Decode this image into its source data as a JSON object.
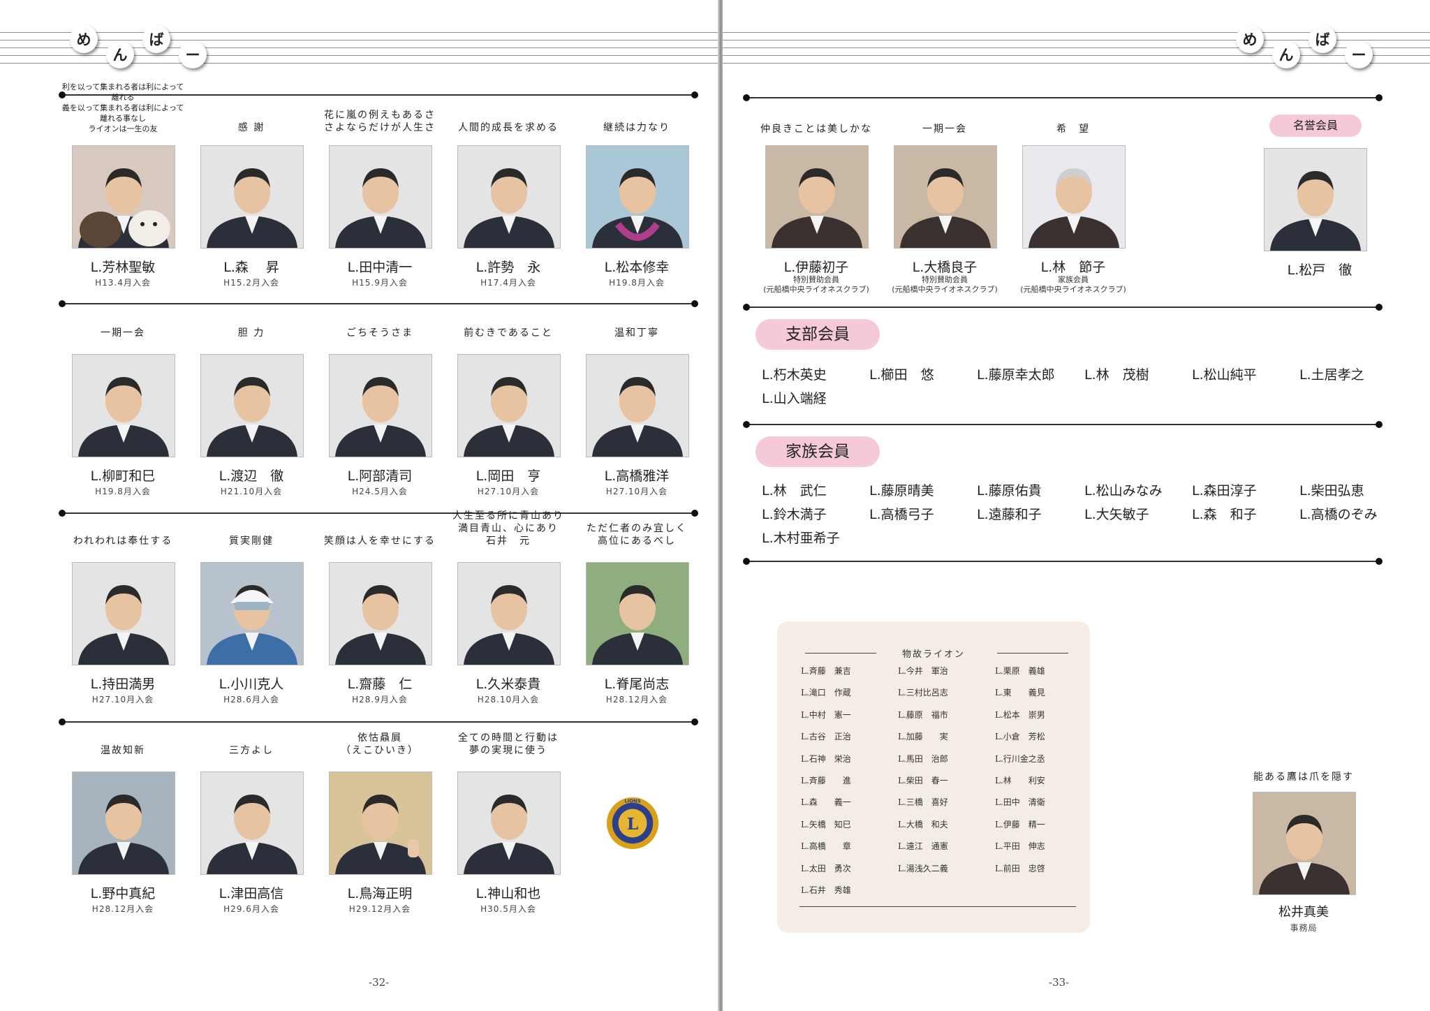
{
  "header": {
    "title_chars": [
      "め",
      "ん",
      "ば",
      "ー"
    ]
  },
  "left_page": {
    "page_number": "-32-",
    "members": [
      {
        "motto": "利を以って集まれる者は利によって離れる\n義を以って集まれる者は利によって離れる事なし\nライオンは一生の友",
        "name": "L.芳林聖敏",
        "joined": "H13.4月入会",
        "photo": "person-with-dogs"
      },
      {
        "motto": "感 謝",
        "name": "L.森　 昇",
        "joined": "H15.2月入会",
        "photo": "portrait"
      },
      {
        "motto": "花に嵐の例えもあるさ\nさよならだけが人生さ",
        "name": "L.田中清一",
        "joined": "H15.9月入会",
        "photo": "portrait"
      },
      {
        "motto": "人間的成長を求める",
        "name": "L.許勢　永",
        "joined": "H17.4月入会",
        "photo": "portrait"
      },
      {
        "motto": "継続は力なり",
        "name": "L.松本修幸",
        "joined": "H19.8月入会",
        "photo": "portrait-lei"
      },
      {
        "motto": "一期一会",
        "name": "L.柳町和巳",
        "joined": "H19.8月入会",
        "photo": "portrait"
      },
      {
        "motto": "胆 力",
        "name": "L.渡辺　徹",
        "joined": "H21.10月入会",
        "photo": "portrait"
      },
      {
        "motto": "ごちそうさま",
        "name": "L.阿部清司",
        "joined": "H24.5月入会",
        "photo": "portrait"
      },
      {
        "motto": "前むきであること",
        "name": "L.岡田　亨",
        "joined": "H27.10月入会",
        "photo": "portrait"
      },
      {
        "motto": "温和丁寧",
        "name": "L.高橋雅洋",
        "joined": "H27.10月入会",
        "photo": "portrait"
      },
      {
        "motto": "われわれは奉仕する",
        "name": "L.持田満男",
        "joined": "H27.10月入会",
        "photo": "portrait"
      },
      {
        "motto": "質実剛健",
        "name": "L.小川克人",
        "joined": "H28.6月入会",
        "photo": "portrait-helmet"
      },
      {
        "motto": "笑顔は人を幸せにする",
        "name": "L.齋藤　仁",
        "joined": "H28.9月入会",
        "photo": "portrait"
      },
      {
        "motto": "人生至る所に青山あり\n満目青山、心にあり\n石井　元",
        "name": "L.久米泰貴",
        "joined": "H28.10月入会",
        "photo": "portrait"
      },
      {
        "motto": "ただ仁者のみ宜しく\n高位にあるべし",
        "name": "L.脊尾尚志",
        "joined": "H28.12月入会",
        "photo": "portrait-outdoor"
      },
      {
        "motto": "温故知新",
        "name": "L.野中真紀",
        "joined": "H28.12月入会",
        "photo": "portrait-sea"
      },
      {
        "motto": "三方よし",
        "name": "L.津田高信",
        "joined": "H29.6月入会",
        "photo": "portrait"
      },
      {
        "motto": "依怙贔屓\n（えこひいき）",
        "name": "L.鳥海正明",
        "joined": "H29.12月入会",
        "photo": "portrait-thumbsup"
      },
      {
        "motto": "全ての時間と行動は\n夢の実現に使う",
        "name": "L.神山和也",
        "joined": "H30.5月入会",
        "photo": "portrait"
      }
    ],
    "logo_text": "LIONS INTERNATIONAL"
  },
  "right_page": {
    "page_number": "-33-",
    "support_members": [
      {
        "motto": "仲良きことは美しかな",
        "name": "L.伊藤初子",
        "role": "特別賛助会員\n(元船橋中央ライオネスクラブ)",
        "photo": "portrait-woman"
      },
      {
        "motto": "一期一会",
        "name": "L.大橋良子",
        "role": "特別賛助会員\n(元船橋中央ライオネスクラブ)",
        "photo": "portrait-woman"
      },
      {
        "motto": "希　望",
        "name": "L.林　節子",
        "role": "家族会員\n(元船橋中央ライオネスクラブ)",
        "photo": "portrait-woman-gray"
      }
    ],
    "honorary": {
      "label": "名誉会員",
      "name": "L.松戸　徹",
      "photo": "portrait"
    },
    "branch": {
      "label": "支部会員",
      "names": [
        "L.朽木英史",
        "L.櫛田　悠",
        "L.藤原幸太郎",
        "L.林　茂樹",
        "L.松山純平",
        "L.土居孝之",
        "L.山入端経"
      ]
    },
    "family": {
      "label": "家族会員",
      "names": [
        "L.林　武仁",
        "L.藤原晴美",
        "L.藤原佑貴",
        "L.松山みなみ",
        "L.森田淳子",
        "L.柴田弘恵",
        "L.鈴木満子",
        "L.高橋弓子",
        "L.遠藤和子",
        "L.大矢敏子",
        "L.森　和子",
        "L.高橋のぞみ",
        "L.木村亜希子"
      ]
    },
    "memorial": {
      "title": "物故ライオン",
      "col1": [
        "L.斉藤　兼吉",
        "L.滝口　作蔵",
        "L.中村　憲一",
        "L.古谷　正治",
        "L.石神　栄治",
        "L.斉藤　　進",
        "L.森　　義一",
        "L.矢橋　知巳",
        "L.高橋　　章",
        "L.太田　勇次",
        "L.石井　秀雄"
      ],
      "col2": [
        "L.今井　軍治",
        "L.三村比呂志",
        "L.藤原　福市",
        "L.加藤　　実",
        "L.馬田　治郎",
        "L.柴田　春一",
        "L.三橋　喜好",
        "L.大橋　和夫",
        "L.遠江　通憲",
        "L.湯浅久二義"
      ],
      "col3": [
        "L.栗原　義雄",
        "L.東　　義見",
        "L.松本　崇男",
        "L.小倉　芳松",
        "L.行川金之丞",
        "L.林　　利安",
        "L.田中　清衛",
        "L.伊藤　精一",
        "L.平田　伸志",
        "L.前田　忠啓"
      ]
    },
    "staff": {
      "motto": "能ある鷹は爪を隠す",
      "name": "松井真美",
      "role": "事務局"
    }
  }
}
